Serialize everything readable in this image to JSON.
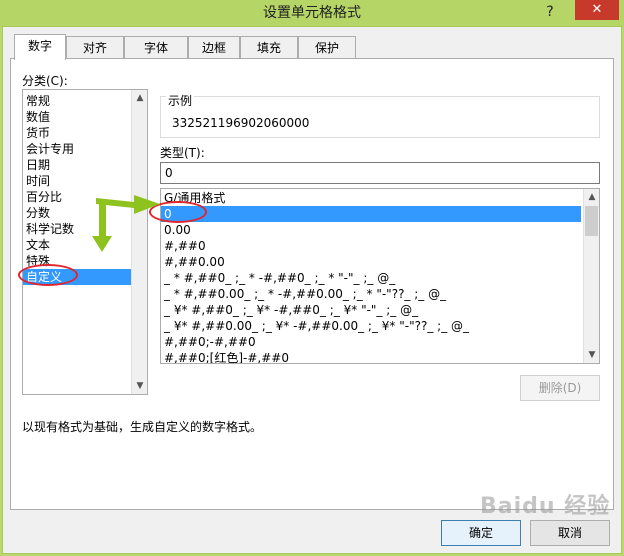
{
  "window": {
    "title": "设置单元格格式",
    "help_label": "?",
    "close_label": "✕"
  },
  "tabs": [
    {
      "label": "数字",
      "active": true
    },
    {
      "label": "对齐"
    },
    {
      "label": "字体"
    },
    {
      "label": "边框"
    },
    {
      "label": "填充"
    },
    {
      "label": "保护"
    }
  ],
  "category": {
    "label": "分类(C):",
    "items": [
      "常规",
      "数值",
      "货币",
      "会计专用",
      "日期",
      "时间",
      "百分比",
      "分数",
      "科学记数",
      "文本",
      "特殊",
      "自定义"
    ],
    "selected": "自定义"
  },
  "sample": {
    "label": "示例",
    "value": "332521196902060000"
  },
  "type": {
    "label": "类型(T):",
    "value": "0",
    "formats": [
      "G/通用格式",
      "0",
      "0.00",
      "#,##0",
      "#,##0.00",
      "_ * #,##0_ ;_ * -#,##0_ ;_ * \"-\"_ ;_ @_",
      "_ * #,##0.00_ ;_ * -#,##0.00_ ;_ * \"-\"??_ ;_ @_",
      "_ ¥* #,##0_ ;_ ¥* -#,##0_ ;_ ¥* \"-\"_ ;_ @_",
      "_ ¥* #,##0.00_ ;_ ¥* -#,##0.00_ ;_ ¥* \"-\"??_ ;_ @_",
      "#,##0;-#,##0",
      "#,##0;[红色]-#,##0"
    ],
    "selected": "0"
  },
  "buttons": {
    "delete_label": "删除(D)",
    "ok_label": "确定",
    "cancel_label": "取消"
  },
  "description": "以现有格式为基础，生成自定义的数字格式。",
  "scroll_icons": {
    "up": "▲",
    "down": "▼"
  },
  "watermark": "Baidu 经验",
  "colors": {
    "selection": "#3399ff",
    "title_bar": "#b5d567",
    "annotation_arrow": "#8dc21f",
    "annotation_ellipse": "#e0262c"
  }
}
